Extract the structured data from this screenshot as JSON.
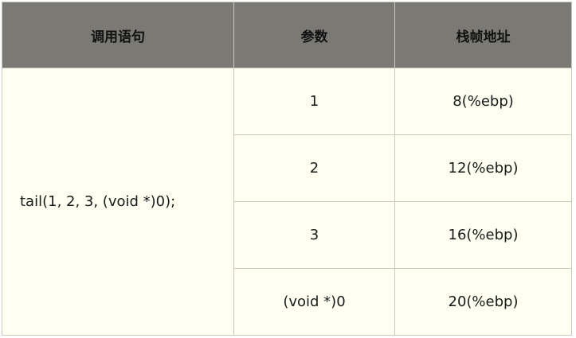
{
  "table": {
    "headers": [
      "调用语句",
      "参数",
      "栈帧地址"
    ],
    "call_statement": "tail(1, 2, 3, (void *)0);",
    "rows": [
      {
        "param": "1",
        "address": "8(%ebp)"
      },
      {
        "param": "2",
        "address": "12(%ebp)"
      },
      {
        "param": "3",
        "address": "16(%ebp)"
      },
      {
        "param": "(void *)0",
        "address": "20(%ebp)"
      }
    ]
  },
  "colors": {
    "header_bg": "#7b7974",
    "cell_bg": "#fffff2",
    "border": "#c9c9c0"
  }
}
